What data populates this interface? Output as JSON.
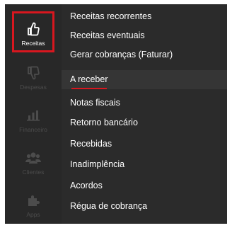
{
  "rail": {
    "items": [
      {
        "label": "Receitas",
        "icon": "thumbs-up-icon",
        "active": true
      },
      {
        "label": "Despesas",
        "icon": "thumbs-down-icon",
        "active": false
      },
      {
        "label": "Financeiro",
        "icon": "bar-chart-icon",
        "active": false
      },
      {
        "label": "Clientes",
        "icon": "users-icon",
        "active": false
      },
      {
        "label": "Apps",
        "icon": "puzzle-icon",
        "active": false
      }
    ]
  },
  "menu": {
    "items": [
      {
        "label": "Receitas recorrentes"
      },
      {
        "label": "Receitas eventuais"
      },
      {
        "label": "Gerar cobranças (Faturar)"
      },
      {
        "label": "A receber",
        "highlighted": true
      },
      {
        "label": "Notas fiscais"
      },
      {
        "label": "Retorno bancário"
      },
      {
        "label": "Recebidas"
      },
      {
        "label": "Inadimplência"
      },
      {
        "label": "Acordos"
      },
      {
        "label": "Régua de cobrança"
      }
    ]
  },
  "colors": {
    "frame_bg": "#2b2b2b",
    "accent_red": "#d8171f",
    "inactive_icon": "#4c4c4c",
    "text": "#ffffff"
  }
}
